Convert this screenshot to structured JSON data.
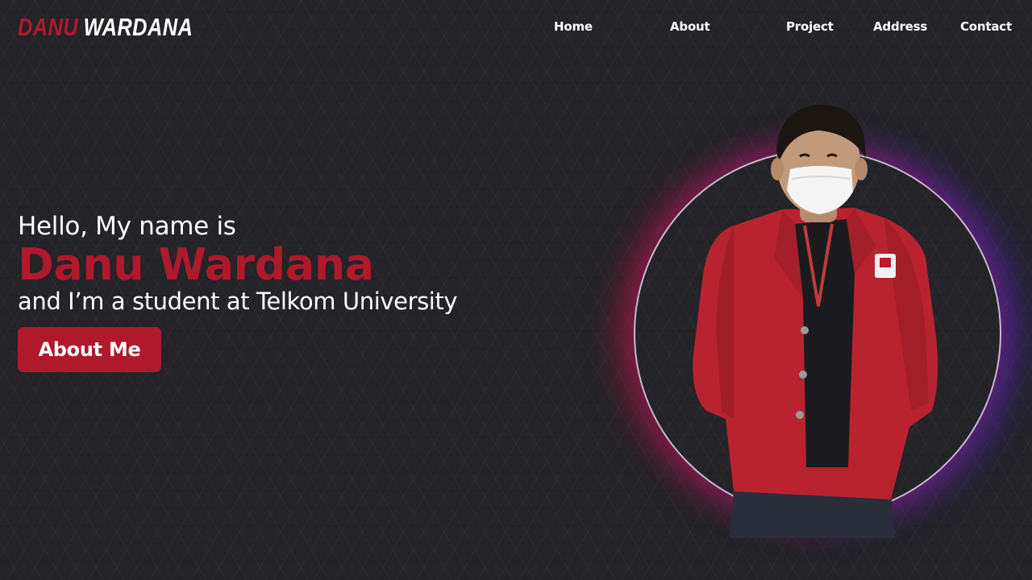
{
  "header": {
    "logo_first": "DANU",
    "logo_last": "WARDANA",
    "nav": [
      {
        "label": "Home"
      },
      {
        "label": "About"
      },
      {
        "label": "Project"
      },
      {
        "label": "Address"
      },
      {
        "label": "Contact"
      }
    ]
  },
  "hero": {
    "greeting": "Hello, My name is",
    "name": "Danu Wardana",
    "tagline": "and I’m a student at Telkom University",
    "cta_label": "About Me"
  },
  "colors": {
    "accent": "#b0182c",
    "background": "#232328",
    "glow_left": "#c81432",
    "glow_right": "#5028e6"
  }
}
